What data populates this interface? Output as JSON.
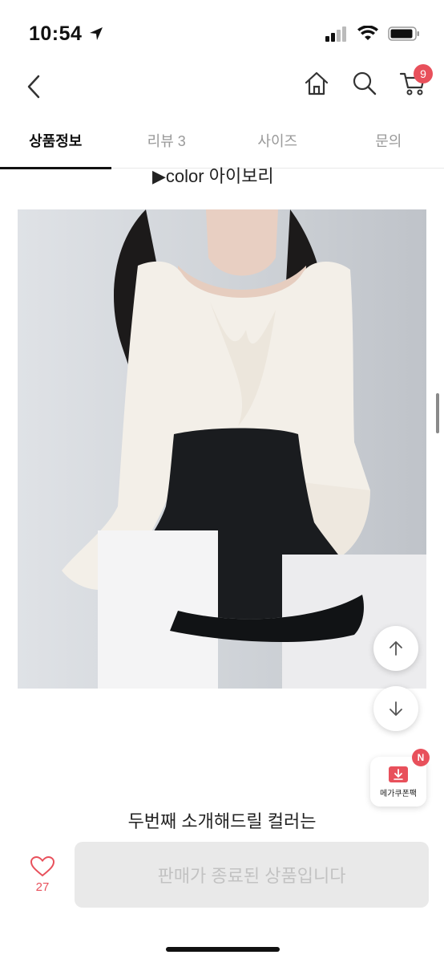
{
  "status": {
    "time": "10:54"
  },
  "nav": {
    "cart_count": "9"
  },
  "tabs": [
    {
      "label": "상품정보"
    },
    {
      "label": "리뷰 3"
    },
    {
      "label": "사이즈"
    },
    {
      "label": "문의"
    }
  ],
  "content": {
    "color_line": "▶color  아이보리",
    "description": "두번째 소개해드릴 컬러는"
  },
  "coupon": {
    "label": "메가쿠폰팩",
    "badge": "N"
  },
  "bottom_bar": {
    "like_count": "27",
    "buy_button_label": "판매가 종료된 상품입니다"
  },
  "colors": {
    "accent": "#e8505b",
    "disabled_bg": "#e9e9e9",
    "disabled_text": "#c2c2c2"
  }
}
